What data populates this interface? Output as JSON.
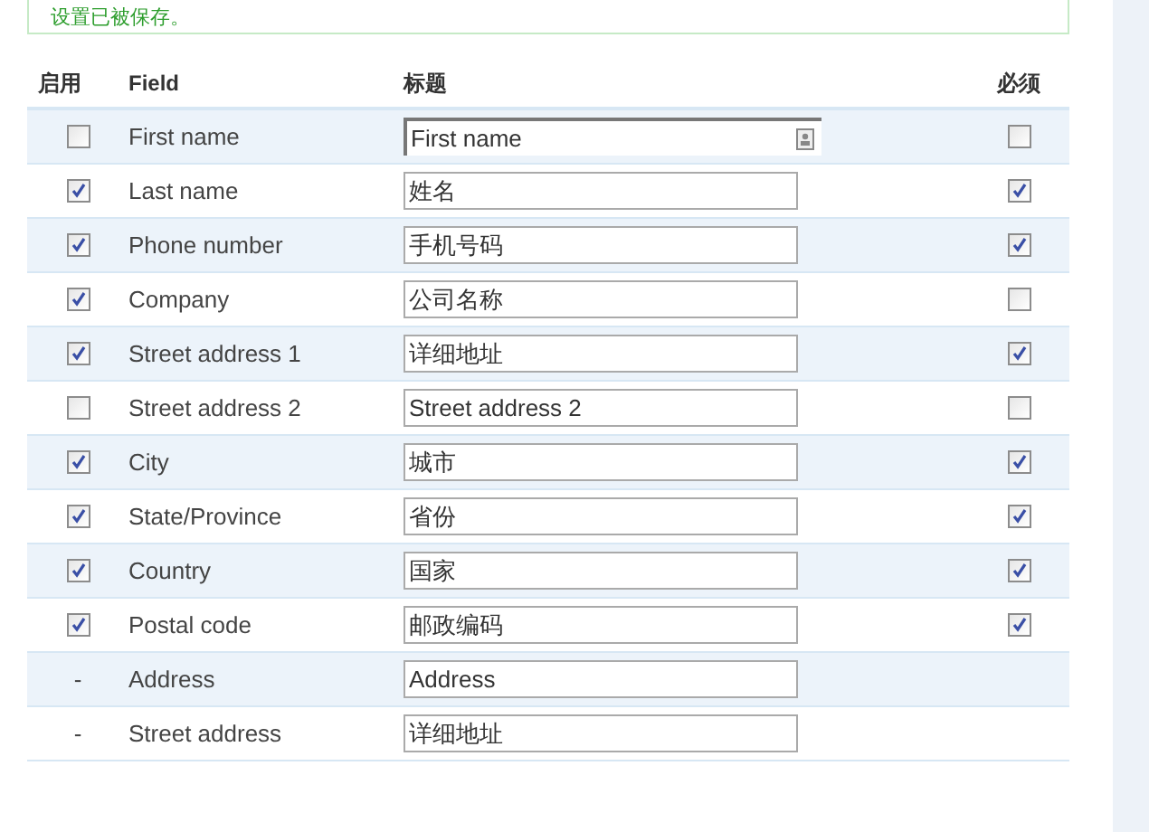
{
  "notice": {
    "text": "设置已被保存。"
  },
  "table": {
    "columns": [
      "启用",
      "Field",
      "标题",
      "必须"
    ],
    "rows": [
      {
        "kind": "checkbox",
        "enabled": false,
        "field": "First name",
        "title": "First name",
        "focused": true,
        "required": false
      },
      {
        "kind": "checkbox",
        "enabled": true,
        "field": "Last name",
        "title": "姓名",
        "focused": false,
        "required": true
      },
      {
        "kind": "checkbox",
        "enabled": true,
        "field": "Phone number",
        "title": "手机号码",
        "focused": false,
        "required": true
      },
      {
        "kind": "checkbox",
        "enabled": true,
        "field": "Company",
        "title": "公司名称",
        "focused": false,
        "required": false
      },
      {
        "kind": "checkbox",
        "enabled": true,
        "field": "Street address 1",
        "title": "详细地址",
        "focused": false,
        "required": true
      },
      {
        "kind": "checkbox",
        "enabled": false,
        "field": "Street address 2",
        "title": "Street address 2",
        "focused": false,
        "required": false
      },
      {
        "kind": "checkbox",
        "enabled": true,
        "field": "City",
        "title": "城市",
        "focused": false,
        "required": true
      },
      {
        "kind": "checkbox",
        "enabled": true,
        "field": "State/Province",
        "title": "省份",
        "focused": false,
        "required": true
      },
      {
        "kind": "checkbox",
        "enabled": true,
        "field": "Country",
        "title": "国家",
        "focused": false,
        "required": true
      },
      {
        "kind": "checkbox",
        "enabled": true,
        "field": "Postal code",
        "title": "邮政编码",
        "focused": false,
        "required": true
      },
      {
        "kind": "fixed",
        "marker": "-",
        "field": "Address",
        "title": "Address",
        "focused": false
      },
      {
        "kind": "fixed",
        "marker": "-",
        "field": "Street address",
        "title": "详细地址",
        "focused": false
      }
    ]
  }
}
